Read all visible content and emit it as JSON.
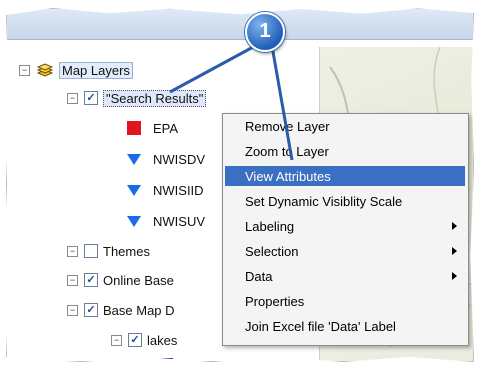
{
  "tree": {
    "root_label": "Map Layers",
    "layer_group_label": "\"Search Results\"",
    "sublayers": [
      "EPA",
      "NWISDV",
      "NWISIID",
      "NWISUV"
    ],
    "themes_label": "Themes",
    "online_label": "Online Base",
    "basemap_label": "Base Map D",
    "lakes_label": "lakes"
  },
  "context_menu": {
    "items": [
      {
        "label": "Remove Layer"
      },
      {
        "label": "Zoom to Layer"
      },
      {
        "label": "View Attributes",
        "highlighted": true
      },
      {
        "label": "Set Dynamic Visiblity Scale"
      },
      {
        "label": "Labeling",
        "submenu": true
      },
      {
        "label": "Selection",
        "submenu": true
      },
      {
        "label": "Data",
        "submenu": true
      },
      {
        "label": "Properties"
      },
      {
        "label": "Join Excel file 'Data' Label"
      }
    ]
  },
  "callout": {
    "number": "1"
  },
  "colors": {
    "highlight": "#3b6fc2",
    "epa_symbol": "#e0161e",
    "triangle_symbol": "#1a6be8",
    "callout": "#1f5fb8"
  },
  "icons": {
    "expander": "minus-box",
    "layers": "layers-icon",
    "submenu": "right-arrow-icon"
  }
}
